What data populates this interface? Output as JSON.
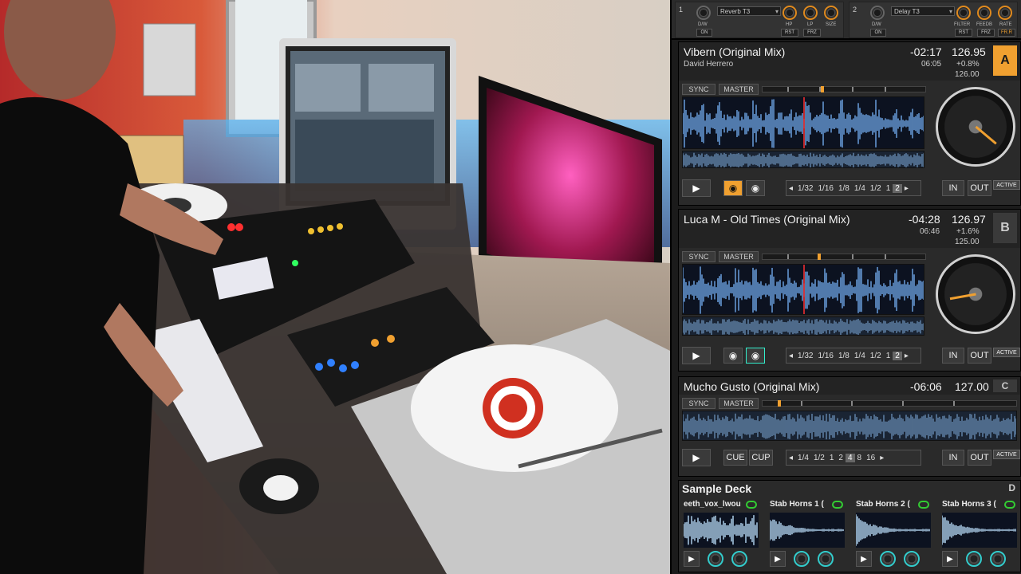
{
  "fx": [
    {
      "num": "1",
      "effect": "Reverb T3",
      "labels": [
        "D/W",
        "HP",
        "LP",
        "SIZE"
      ],
      "buttons": [
        "ON",
        "RST",
        "FRZ"
      ]
    },
    {
      "num": "2",
      "effect": "Delay T3",
      "labels": [
        "D/W",
        "FILTER",
        "FEEDB",
        "RATE"
      ],
      "buttons": [
        "ON",
        "RST",
        "FRZ",
        "FR.R"
      ]
    }
  ],
  "decks": [
    {
      "letter": "A",
      "title": "Vibern (Original Mix)",
      "artist": "David Herrero",
      "remaining": "-02:17",
      "total": "06:05",
      "bpm": "126.95",
      "pitch": "+0.8%",
      "base_bpm": "126.00",
      "sync": "SYNC",
      "master": "MASTER",
      "in": "IN",
      "out": "OUT",
      "active": "ACTIVE",
      "loops": [
        "1/32",
        "1/16",
        "1/8",
        "1/4",
        "1/2",
        "1",
        "2"
      ],
      "loop_selected": "2",
      "progress": 0.36
    },
    {
      "letter": "B",
      "title": "Luca M - Old Times (Original Mix)",
      "artist": "",
      "remaining": "-04:28",
      "total": "06:46",
      "bpm": "126.97",
      "pitch": "+1.6%",
      "base_bpm": "125.00",
      "sync": "SYNC",
      "master": "MASTER",
      "in": "IN",
      "out": "OUT",
      "active": "ACTIVE",
      "loops": [
        "1/32",
        "1/16",
        "1/8",
        "1/4",
        "1/2",
        "1",
        "2"
      ],
      "loop_selected": "2",
      "progress": 0.34
    },
    {
      "letter": "C",
      "title": "Mucho Gusto (Original Mix)",
      "remaining": "-06:06",
      "bpm": "127.00",
      "sync": "SYNC",
      "master": "MASTER",
      "cue": "CUE",
      "cup": "CUP",
      "in": "IN",
      "out": "OUT",
      "active": "ACTIVE",
      "loops": [
        "1/4",
        "1/2",
        "1",
        "2",
        "4",
        "8",
        "16"
      ],
      "loop_selected": "4",
      "progress": 0.06
    }
  ],
  "sample_deck": {
    "title": "Sample Deck",
    "letter": "D",
    "slots": [
      "eeth_vox_lwou",
      "Stab Horns 1 (",
      "Stab Horns 2 (",
      "Stab Horns 3 ("
    ]
  },
  "colors": {
    "accent": "#f0a030",
    "wave": "#6fa8e8",
    "panel": "#2a2a2a"
  }
}
